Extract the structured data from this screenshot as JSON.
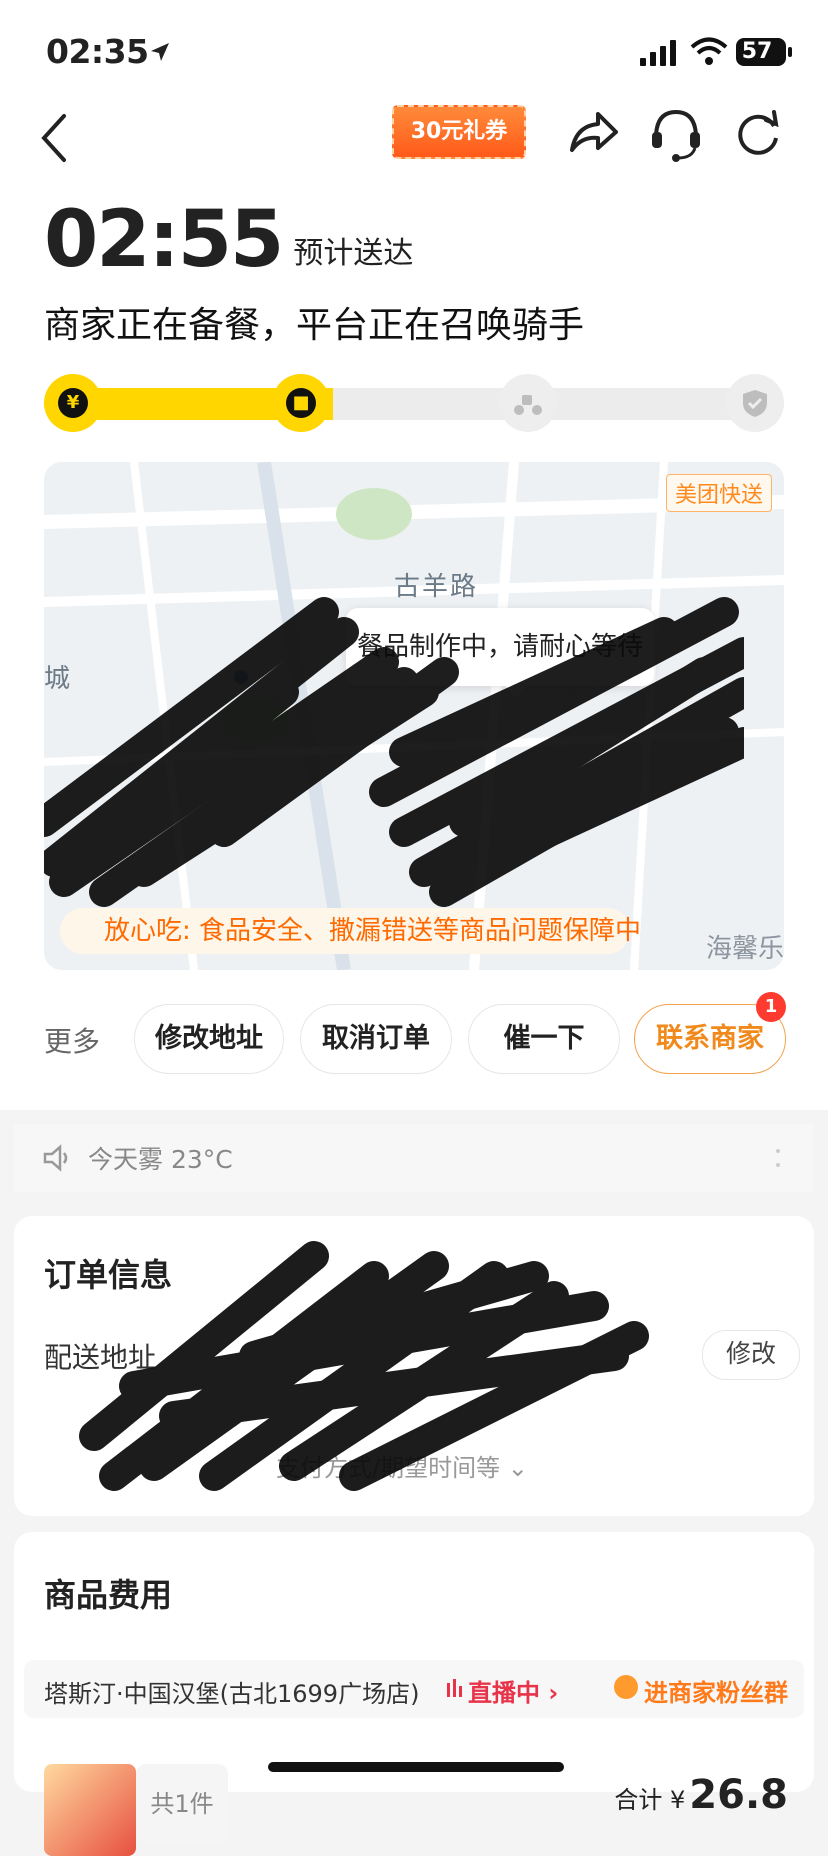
{
  "status_bar": {
    "time": "02:35",
    "battery": "57"
  },
  "header": {
    "coupon": "30元礼券"
  },
  "eta": {
    "time": "02:55",
    "label": "预计送达"
  },
  "status_text": "商家正在备餐，平台正在召唤骑手",
  "progress": {
    "fraction": 0.39,
    "steps": [
      {
        "name": "paid",
        "icon": "yen-icon",
        "glyph": "¥",
        "active": true
      },
      {
        "name": "preparing",
        "icon": "meal-box-icon",
        "glyph": "■",
        "active": true
      },
      {
        "name": "delivering",
        "icon": "rider-icon",
        "glyph": "",
        "active": false
      },
      {
        "name": "delivered",
        "icon": "check-shield-icon",
        "glyph": "",
        "active": false
      }
    ]
  },
  "map": {
    "badge": "美团快送",
    "road": "古羊路",
    "bubble": "餐品制作中，请耐心等待",
    "left_label": "城",
    "right_label": "海馨乐",
    "guarantee": "放心吃: 食品安全、撒漏错送等商品问题保障中"
  },
  "actions": {
    "more": "更多",
    "buttons": [
      "修改地址",
      "取消订单",
      "催一下",
      "联系商家"
    ],
    "badge_count": "1"
  },
  "weather": {
    "text": "今天雾 23°C"
  },
  "order_info": {
    "title": "订单信息",
    "address_label": "配送地址",
    "modify": "修改",
    "more_link": "支付方式/期望时间等"
  },
  "fees": {
    "title": "商品费用",
    "shop": "塔斯汀·中国汉堡(古北1699广场店)",
    "live": "直播中",
    "fan_group": "进商家粉丝群",
    "count": "共1件",
    "total_label": "合计",
    "currency": "¥",
    "total": "26.8"
  },
  "colors": {
    "accent": "#ffd600",
    "orange": "#ff7a1a",
    "live_red": "#e8344a"
  }
}
